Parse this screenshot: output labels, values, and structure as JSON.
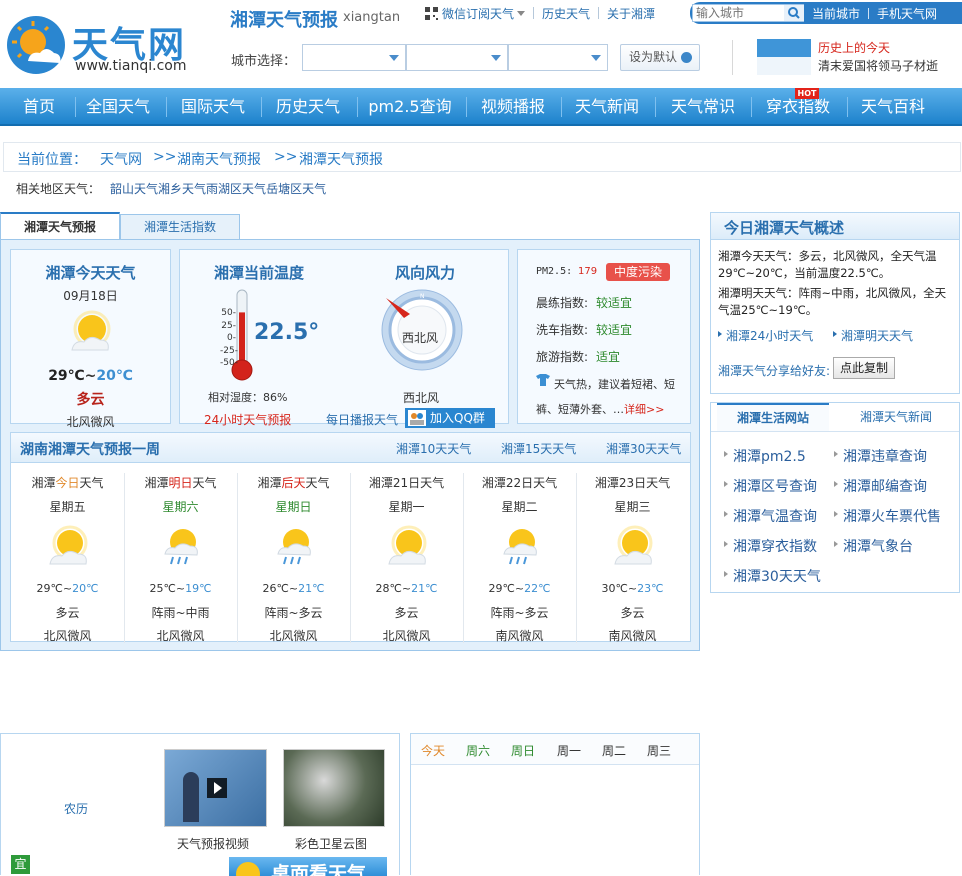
{
  "header": {
    "logo_text": "天气网",
    "logo_url": "www.tianqi.com",
    "title": "湘潭天气预报",
    "pinyin": "xiangtan",
    "top_links": [
      "微信订阅天气",
      "历史天气",
      "关于湘潭"
    ],
    "search_placeholder": "输入城市",
    "right_links": [
      "当前城市",
      "手机天气网"
    ],
    "city_select_label": "城市选择：",
    "default_button": "设为默认",
    "history_title": "历史上的今天",
    "history_text": "清末爱国将领马子材逝"
  },
  "nav": {
    "items": [
      "首页",
      "全国天气",
      "国际天气",
      "历史天气",
      "pm2.5查询",
      "视频播报",
      "天气新闻",
      "天气常识",
      "穿衣指数",
      "天气百科"
    ],
    "hot_badge": "HOT"
  },
  "breadcrumb": {
    "label": "当前位置：",
    "items": [
      "天气网",
      "湖南天气预报",
      "湘潭天气预报"
    ],
    "sep": ">>"
  },
  "related": {
    "label": "相关地区天气：",
    "items": [
      "韶山天气",
      "湘乡天气",
      "雨湖区天气",
      "岳塘区天气"
    ]
  },
  "tabs": [
    "湘潭天气预报",
    "湘潭生活指数"
  ],
  "today": {
    "title": "湘潭今天天气",
    "date": "09月18日",
    "temp_high": "29℃",
    "tilde": "~",
    "temp_low": "20℃",
    "condition": "多云",
    "wind": "北风微风"
  },
  "current": {
    "title": "湘潭当前温度",
    "temp": "22.5°",
    "scale": [
      "50-",
      "25-",
      "0-",
      "-25-",
      "-50-"
    ],
    "humidity": "相对湿度：86%",
    "forecast_link": "24小时天气预报",
    "level_fraction": 0.72
  },
  "wind": {
    "title": "风向风力",
    "direction": "西北风",
    "label": "西北风",
    "compass": "N"
  },
  "qq": {
    "text": "每日播报天气",
    "button": "加入QQ群"
  },
  "indices": {
    "pm_label": "PM2.5:",
    "pm_value": "179",
    "pm_level": "中度污染",
    "rows": [
      {
        "label": "晨练指数:",
        "value": "较适宜"
      },
      {
        "label": "洗车指数:",
        "value": "较适宜"
      },
      {
        "label": "旅游指数:",
        "value": "适宜"
      }
    ],
    "tip": "天气热，建议着短裙、短裤、短薄外套、…",
    "detail": "详细>>"
  },
  "week": {
    "title": "湖南湘潭天气预报一周",
    "links": [
      "湘潭10天天气",
      "湘潭15天天气",
      "湘潭30天天气"
    ],
    "days": [
      {
        "pre": "湘潭",
        "hl": "今日",
        "post": "天气",
        "hl_color": "#e0882a",
        "weekday": "星期五",
        "weekday_color": "#333333",
        "high": "29℃",
        "low": "20℃",
        "cond": "多云",
        "wind": "北风微风",
        "icon": "partly-cloudy"
      },
      {
        "pre": "湘潭",
        "hl": "明日",
        "post": "天气",
        "hl_color": "#d6261c",
        "weekday": "星期六",
        "weekday_color": "#2e8a2e",
        "high": "25℃",
        "low": "19℃",
        "cond": "阵雨~中雨",
        "wind": "北风微风",
        "icon": "rain"
      },
      {
        "pre": "湘潭",
        "hl": "后天",
        "post": "天气",
        "hl_color": "#d6261c",
        "weekday": "星期日",
        "weekday_color": "#2e8a2e",
        "high": "26℃",
        "low": "21℃",
        "cond": "阵雨~多云",
        "wind": "北风微风",
        "icon": "rain"
      },
      {
        "pre": "湘潭",
        "hl": "21日",
        "post": "天气",
        "hl_color": "#333333",
        "weekday": "星期一",
        "weekday_color": "#333333",
        "high": "28℃",
        "low": "21℃",
        "cond": "多云",
        "wind": "北风微风",
        "icon": "partly-cloudy"
      },
      {
        "pre": "湘潭",
        "hl": "22日",
        "post": "天气",
        "hl_color": "#333333",
        "weekday": "星期二",
        "weekday_color": "#333333",
        "high": "29℃",
        "low": "22℃",
        "cond": "阵雨~多云",
        "wind": "南风微风",
        "icon": "rain"
      },
      {
        "pre": "湘潭",
        "hl": "23日",
        "post": "天气",
        "hl_color": "#333333",
        "weekday": "星期三",
        "weekday_color": "#333333",
        "high": "30℃",
        "low": "23℃",
        "cond": "多云",
        "wind": "南风微风",
        "icon": "partly-cloudy"
      }
    ]
  },
  "overview": {
    "title": "今日湘潭天气概述",
    "text1": "湘潭今天天气：多云，北风微风，全天气温29℃~20℃，当前温度22.5℃。",
    "text2": "湘潭明天天气：阵雨~中雨，北风微风，全天气温25℃~19℃。",
    "link1": "湘潭24小时天气",
    "link2": "湘潭明天天气",
    "share": "湘潭天气分享给好友:",
    "copy_button": "点此复制"
  },
  "life": {
    "tabs": [
      "湘潭生活网站",
      "湘潭天气新闻"
    ],
    "links": [
      "湘潭pm2.5",
      "湘潭违章查询",
      "湘潭区号查询",
      "湘潭邮编查询",
      "湘潭气温查询",
      "湘潭火车票代售",
      "湘潭穿衣指数",
      "湘潭气象台",
      "湘潭30天天气"
    ]
  },
  "bottom": {
    "lunar_label": "农历",
    "yi": "宜",
    "video_caption": "天气预报视频",
    "satellite_caption": "彩色卫星云图",
    "banner_text": "桌面看天气",
    "days": [
      "今天",
      "周六",
      "周日",
      "周一",
      "周二",
      "周三"
    ],
    "day_colors": [
      "#e0882a",
      "#2e8a2e",
      "#2e8a2e",
      "#333333",
      "#333333",
      "#333333"
    ]
  },
  "colors": {
    "brand": "#2a7cc6",
    "nav": "#1d82cc",
    "alert": "#e2231a"
  }
}
